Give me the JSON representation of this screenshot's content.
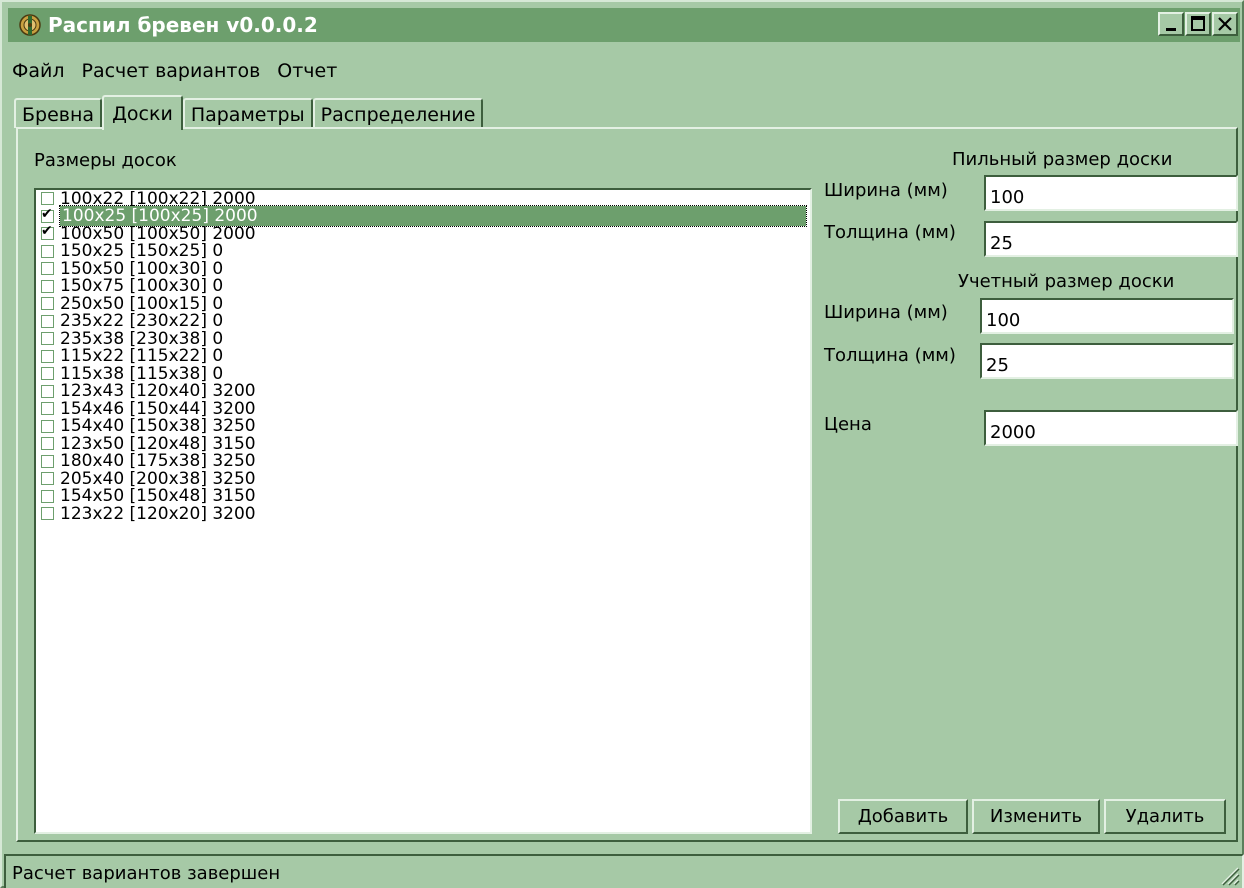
{
  "window": {
    "title": "Распил бревен v0.0.0.2"
  },
  "menu": [
    "Файл",
    "Расчет вариантов",
    "Отчет"
  ],
  "tabs": [
    "Бревна",
    "Доски",
    "Параметры",
    "Распределение"
  ],
  "active_tab": "Доски",
  "boards_label": "Размеры досок",
  "boards": [
    {
      "label": "100x22 [100x22] 2000",
      "checked": false,
      "selected": false
    },
    {
      "label": "100x25 [100x25] 2000",
      "checked": true,
      "selected": true
    },
    {
      "label": "100x50 [100x50] 2000",
      "checked": true,
      "selected": false
    },
    {
      "label": "150x25 [150x25] 0",
      "checked": false,
      "selected": false
    },
    {
      "label": "150x50 [100x30] 0",
      "checked": false,
      "selected": false
    },
    {
      "label": "150x75 [100x30] 0",
      "checked": false,
      "selected": false
    },
    {
      "label": "250x50 [100x15] 0",
      "checked": false,
      "selected": false
    },
    {
      "label": "235x22 [230x22] 0",
      "checked": false,
      "selected": false
    },
    {
      "label": "235x38 [230x38] 0",
      "checked": false,
      "selected": false
    },
    {
      "label": "115x22 [115x22] 0",
      "checked": false,
      "selected": false
    },
    {
      "label": "115x38 [115x38] 0",
      "checked": false,
      "selected": false
    },
    {
      "label": "123x43 [120x40] 3200",
      "checked": false,
      "selected": false
    },
    {
      "label": "154x46 [150x44] 3200",
      "checked": false,
      "selected": false
    },
    {
      "label": "154x40 [150x38] 3250",
      "checked": false,
      "selected": false
    },
    {
      "label": "123x50 [120x48] 3150",
      "checked": false,
      "selected": false
    },
    {
      "label": "180x40 [175x38] 3250",
      "checked": false,
      "selected": false
    },
    {
      "label": "205x40 [200x38] 3250",
      "checked": false,
      "selected": false
    },
    {
      "label": "154x50 [150x48] 3150",
      "checked": false,
      "selected": false
    },
    {
      "label": "123x22 [120x20] 3200",
      "checked": false,
      "selected": false
    }
  ],
  "saw_size": {
    "heading": "Пильный размер доски",
    "width_label": "Ширина (мм)",
    "width_value": "100",
    "thickness_label": "Толщина (мм)",
    "thickness_value": "25"
  },
  "account_size": {
    "heading": "Учетный размер доски",
    "width_label": "Ширина (мм)",
    "width_value": "100",
    "thickness_label": "Толщина (мм)",
    "thickness_value": "25"
  },
  "price": {
    "label": "Цена",
    "value": "2000"
  },
  "buttons": {
    "add": "Добавить",
    "edit": "Изменить",
    "delete": "Удалить"
  },
  "status": "Расчет вариантов завершен",
  "colors": {
    "window_bg": "#a6c9a6",
    "titlebar": "#6d9f6d",
    "selection": "#6d9f6d"
  }
}
